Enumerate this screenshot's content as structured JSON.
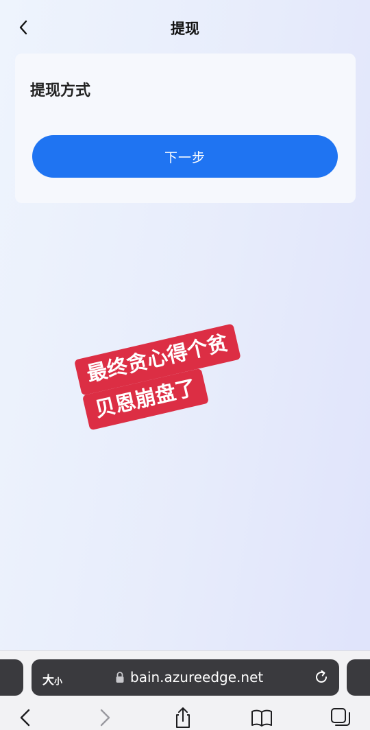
{
  "header": {
    "title": "提现"
  },
  "card": {
    "title": "提现方式",
    "next_button": "下一步"
  },
  "sticker": {
    "line1": "最终贪心得个贫",
    "line2": "贝恩崩盘了"
  },
  "browser": {
    "text_size_big": "大",
    "text_size_small": "小",
    "url": "bain.azureedge.net"
  },
  "colors": {
    "primary_button": "#1f74f2",
    "sticker": "#dc2e44"
  }
}
